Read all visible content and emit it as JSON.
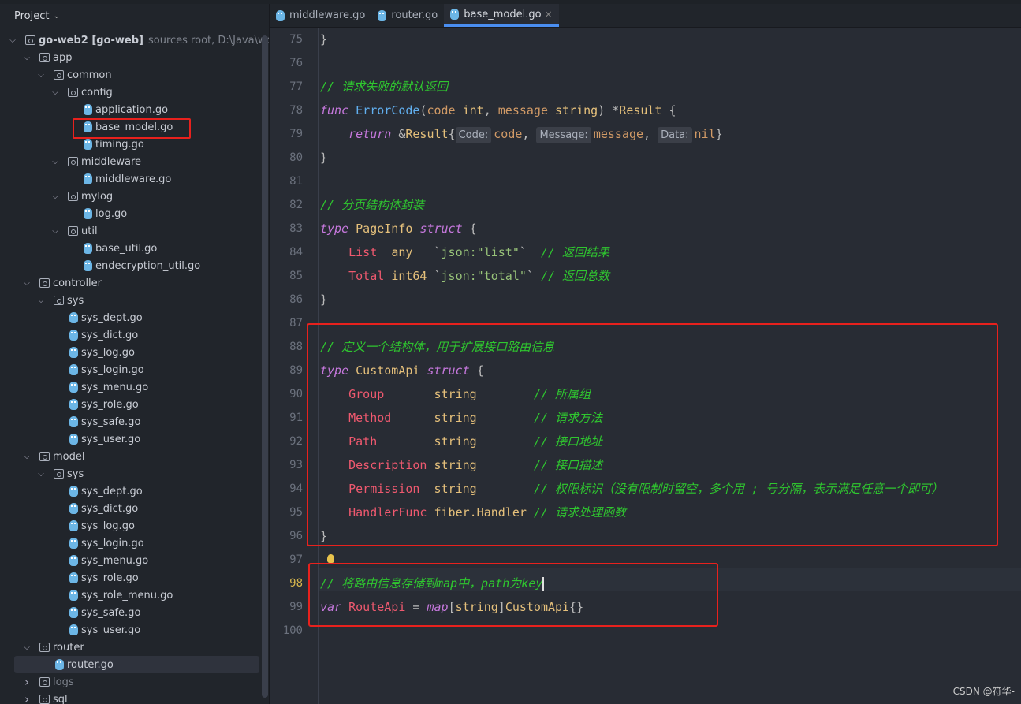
{
  "sidebar": {
    "title": "Project",
    "items": [
      {
        "level": 0,
        "type": "module",
        "name": "go-web2 [go-web]",
        "hint": "sources root,  D:\\Java\\wor",
        "expanded": true
      },
      {
        "level": 1,
        "type": "folder",
        "name": "app",
        "expanded": true
      },
      {
        "level": 2,
        "type": "folder",
        "name": "common",
        "expanded": true
      },
      {
        "level": 3,
        "type": "folder",
        "name": "config",
        "expanded": true
      },
      {
        "level": 4,
        "type": "file",
        "name": "application.go"
      },
      {
        "level": 4,
        "type": "file",
        "name": "base_model.go",
        "highlighted": true
      },
      {
        "level": 4,
        "type": "file",
        "name": "timing.go"
      },
      {
        "level": 3,
        "type": "folder",
        "name": "middleware",
        "expanded": true
      },
      {
        "level": 4,
        "type": "file",
        "name": "middleware.go"
      },
      {
        "level": 3,
        "type": "folder",
        "name": "mylog",
        "expanded": true
      },
      {
        "level": 4,
        "type": "file",
        "name": "log.go"
      },
      {
        "level": 3,
        "type": "folder",
        "name": "util",
        "expanded": true
      },
      {
        "level": 4,
        "type": "file",
        "name": "base_util.go"
      },
      {
        "level": 4,
        "type": "file",
        "name": "endecryption_util.go"
      },
      {
        "level": 1,
        "type": "folder",
        "name": "controller",
        "expanded": true
      },
      {
        "level": 2,
        "type": "folder",
        "name": "sys",
        "expanded": true
      },
      {
        "level": 3,
        "type": "file",
        "name": "sys_dept.go"
      },
      {
        "level": 3,
        "type": "file",
        "name": "sys_dict.go"
      },
      {
        "level": 3,
        "type": "file",
        "name": "sys_log.go"
      },
      {
        "level": 3,
        "type": "file",
        "name": "sys_login.go"
      },
      {
        "level": 3,
        "type": "file",
        "name": "sys_menu.go"
      },
      {
        "level": 3,
        "type": "file",
        "name": "sys_role.go"
      },
      {
        "level": 3,
        "type": "file",
        "name": "sys_safe.go"
      },
      {
        "level": 3,
        "type": "file",
        "name": "sys_user.go"
      },
      {
        "level": 1,
        "type": "folder",
        "name": "model",
        "expanded": true
      },
      {
        "level": 2,
        "type": "folder",
        "name": "sys",
        "expanded": true
      },
      {
        "level": 3,
        "type": "file",
        "name": "sys_dept.go"
      },
      {
        "level": 3,
        "type": "file",
        "name": "sys_dict.go"
      },
      {
        "level": 3,
        "type": "file",
        "name": "sys_log.go"
      },
      {
        "level": 3,
        "type": "file",
        "name": "sys_login.go"
      },
      {
        "level": 3,
        "type": "file",
        "name": "sys_menu.go"
      },
      {
        "level": 3,
        "type": "file",
        "name": "sys_role.go"
      },
      {
        "level": 3,
        "type": "file",
        "name": "sys_role_menu.go"
      },
      {
        "level": 3,
        "type": "file",
        "name": "sys_safe.go"
      },
      {
        "level": 3,
        "type": "file",
        "name": "sys_user.go"
      },
      {
        "level": 1,
        "type": "folder",
        "name": "router",
        "expanded": true
      },
      {
        "level": 2,
        "type": "file",
        "name": "router.go",
        "selected": true
      },
      {
        "level": 1,
        "type": "folder",
        "name": "logs",
        "expanded": false,
        "dim": true
      },
      {
        "level": 1,
        "type": "folder",
        "name": "sql",
        "expanded": false
      }
    ]
  },
  "tabs": [
    {
      "label": "middleware.go"
    },
    {
      "label": "router.go"
    },
    {
      "label": "base_model.go",
      "active": true,
      "close": "×"
    }
  ],
  "editor": {
    "current_line": 98,
    "lines": [
      {
        "n": "75",
        "t": [
          [
            "pl",
            "}"
          ]
        ]
      },
      {
        "n": "76",
        "t": []
      },
      {
        "n": "77",
        "t": [
          [
            "cm",
            "// 请求失败的默认返回"
          ]
        ]
      },
      {
        "n": "78",
        "t": [
          [
            "kw",
            "func"
          ],
          [
            "pl",
            " "
          ],
          [
            "fn",
            "ErrorCode"
          ],
          [
            "pl",
            "("
          ],
          [
            "pa",
            "code"
          ],
          [
            "pl",
            " "
          ],
          [
            "ty",
            "int"
          ],
          [
            "pl",
            ", "
          ],
          [
            "pa",
            "message"
          ],
          [
            "pl",
            " "
          ],
          [
            "ty",
            "string"
          ],
          [
            "pl",
            ") *"
          ],
          [
            "ty",
            "Result"
          ],
          [
            "pl",
            " {"
          ]
        ]
      },
      {
        "n": "79",
        "t": [
          [
            "pl",
            "    "
          ],
          [
            "kw",
            "return"
          ],
          [
            "pl",
            " &"
          ],
          [
            "ty",
            "Result"
          ],
          [
            "pl",
            "{"
          ],
          [
            "inl",
            "Code:"
          ],
          [
            "pa",
            "code"
          ],
          [
            "pl",
            ", "
          ],
          [
            "inl",
            "Message:"
          ],
          [
            "pa",
            "message"
          ],
          [
            "pl",
            ", "
          ],
          [
            "inl",
            "Data:"
          ],
          [
            "pa",
            "nil"
          ],
          [
            "pl",
            "}"
          ]
        ]
      },
      {
        "n": "80",
        "t": [
          [
            "pl",
            "}"
          ]
        ]
      },
      {
        "n": "81",
        "t": []
      },
      {
        "n": "82",
        "t": [
          [
            "cm",
            "// 分页结构体封装"
          ]
        ]
      },
      {
        "n": "83",
        "t": [
          [
            "kw",
            "type"
          ],
          [
            "pl",
            " "
          ],
          [
            "ty",
            "PageInfo"
          ],
          [
            "pl",
            " "
          ],
          [
            "kw",
            "struct"
          ],
          [
            "pl",
            " {"
          ]
        ]
      },
      {
        "n": "84",
        "t": [
          [
            "pl",
            "    "
          ],
          [
            "fi",
            "List"
          ],
          [
            "pl",
            "  "
          ],
          [
            "ty",
            "any"
          ],
          [
            "pl",
            "   `"
          ],
          [
            "st",
            "json:\"list\""
          ],
          [
            "pl",
            "`  "
          ],
          [
            "cm",
            "// 返回结果"
          ]
        ]
      },
      {
        "n": "85",
        "t": [
          [
            "pl",
            "    "
          ],
          [
            "fi",
            "Total"
          ],
          [
            "pl",
            " "
          ],
          [
            "ty",
            "int64"
          ],
          [
            "pl",
            " `"
          ],
          [
            "st",
            "json:\"total\""
          ],
          [
            "pl",
            "` "
          ],
          [
            "cm",
            "// 返回总数"
          ]
        ]
      },
      {
        "n": "86",
        "t": [
          [
            "pl",
            "}"
          ]
        ]
      },
      {
        "n": "87",
        "t": []
      },
      {
        "n": "88",
        "t": [
          [
            "cm",
            "// 定义一个结构体，用于扩展接口路由信息"
          ]
        ]
      },
      {
        "n": "89",
        "t": [
          [
            "kw",
            "type"
          ],
          [
            "pl",
            " "
          ],
          [
            "ty",
            "CustomApi"
          ],
          [
            "pl",
            " "
          ],
          [
            "kw",
            "struct"
          ],
          [
            "pl",
            " {"
          ]
        ]
      },
      {
        "n": "90",
        "t": [
          [
            "pl",
            "    "
          ],
          [
            "fi",
            "Group"
          ],
          [
            "pl",
            "       "
          ],
          [
            "ty",
            "string"
          ],
          [
            "pl",
            "        "
          ],
          [
            "cm",
            "// 所属组"
          ]
        ]
      },
      {
        "n": "91",
        "t": [
          [
            "pl",
            "    "
          ],
          [
            "fi",
            "Method"
          ],
          [
            "pl",
            "      "
          ],
          [
            "ty",
            "string"
          ],
          [
            "pl",
            "        "
          ],
          [
            "cm",
            "// 请求方法"
          ]
        ]
      },
      {
        "n": "92",
        "t": [
          [
            "pl",
            "    "
          ],
          [
            "fi",
            "Path"
          ],
          [
            "pl",
            "        "
          ],
          [
            "ty",
            "string"
          ],
          [
            "pl",
            "        "
          ],
          [
            "cm",
            "// 接口地址"
          ]
        ]
      },
      {
        "n": "93",
        "t": [
          [
            "pl",
            "    "
          ],
          [
            "fi",
            "Description"
          ],
          [
            "pl",
            " "
          ],
          [
            "ty",
            "string"
          ],
          [
            "pl",
            "        "
          ],
          [
            "cm",
            "// 接口描述"
          ]
        ]
      },
      {
        "n": "94",
        "t": [
          [
            "pl",
            "    "
          ],
          [
            "fi",
            "Permission"
          ],
          [
            "pl",
            "  "
          ],
          [
            "ty",
            "string"
          ],
          [
            "pl",
            "        "
          ],
          [
            "cm",
            "// 权限标识（没有限制时留空，多个用 ; 号分隔，表示满足任意一个即可）"
          ]
        ]
      },
      {
        "n": "95",
        "t": [
          [
            "pl",
            "    "
          ],
          [
            "fi",
            "HandlerFunc"
          ],
          [
            "pl",
            " "
          ],
          [
            "ty",
            "fiber.Handler"
          ],
          [
            "pl",
            " "
          ],
          [
            "cm",
            "// 请求处理函数"
          ]
        ]
      },
      {
        "n": "96",
        "t": [
          [
            "pl",
            "}"
          ]
        ]
      },
      {
        "n": "97",
        "t": []
      },
      {
        "n": "98",
        "t": [
          [
            "cm",
            "// 将路由信息存储到map中，path为key"
          ]
        ]
      },
      {
        "n": "99",
        "t": [
          [
            "kw",
            "var"
          ],
          [
            "pl",
            " "
          ],
          [
            "fi",
            "RouteApi"
          ],
          [
            "pl",
            " = "
          ],
          [
            "kw",
            "map"
          ],
          [
            "pl",
            "["
          ],
          [
            "ty",
            "string"
          ],
          [
            "pl",
            "]"
          ],
          [
            "ty",
            "CustomApi"
          ],
          [
            "pl",
            "{}"
          ]
        ]
      },
      {
        "n": "100",
        "t": []
      }
    ]
  },
  "watermark": "CSDN @符华-",
  "colors": {
    "annotation_box": "#e8211d",
    "accent": "#4a8ef0"
  }
}
